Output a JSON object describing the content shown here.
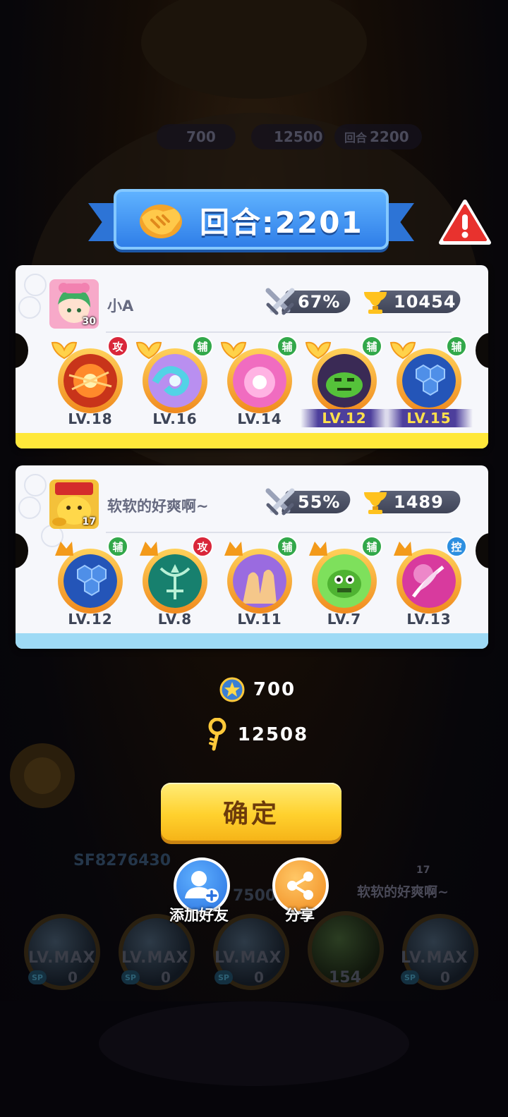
{
  "background": {
    "hud": {
      "stars": "700",
      "keys": "12500",
      "round_label": "回合",
      "round_value": "2200"
    },
    "score_id": "SF8276430",
    "center_value": "7500",
    "opponent_name": "软软的好爽啊~",
    "opponent_level": "17",
    "bottom_levels": [
      "LV.MAX",
      "LV.MAX",
      "LV.MAX",
      "LV.MAX"
    ],
    "sp_label": "SP",
    "sp_values": [
      "0",
      "0",
      "0",
      "0"
    ],
    "center_count": "154"
  },
  "title": {
    "text": "回合:2201",
    "color": "#2f7ee8"
  },
  "players": [
    {
      "name": "小A",
      "level": "30",
      "win_rate": "67%",
      "trophies": "10454",
      "band_color": "#ffe83a",
      "heroes": [
        {
          "badge": "攻",
          "badge_color": "#d9263a",
          "level": "LV.18",
          "highlight": false,
          "orb": "fire-orb"
        },
        {
          "badge": "辅",
          "badge_color": "#32a84a",
          "level": "LV.16",
          "highlight": false,
          "orb": "wave-orb"
        },
        {
          "badge": "辅",
          "badge_color": "#32a84a",
          "level": "LV.14",
          "highlight": false,
          "orb": "pink-orb"
        },
        {
          "badge": "辅",
          "badge_color": "#32a84a",
          "level": "LV.12",
          "highlight": true,
          "orb": "slime-orb"
        },
        {
          "badge": "辅",
          "badge_color": "#32a84a",
          "level": "LV.15",
          "highlight": true,
          "orb": "hex-orb"
        }
      ]
    },
    {
      "name": "软软的好爽啊~",
      "level": "17",
      "win_rate": "55%",
      "trophies": "1489",
      "band_color": "#9edaf5",
      "heroes": [
        {
          "badge": "辅",
          "badge_color": "#32a84a",
          "level": "LV.12",
          "highlight": false,
          "orb": "hex-orb"
        },
        {
          "badge": "攻",
          "badge_color": "#d9263a",
          "level": "LV.8",
          "highlight": false,
          "orb": "bow-orb"
        },
        {
          "badge": "辅",
          "badge_color": "#32a84a",
          "level": "LV.11",
          "highlight": false,
          "orb": "shadow-orb"
        },
        {
          "badge": "辅",
          "badge_color": "#32a84a",
          "level": "LV.7",
          "highlight": false,
          "orb": "goblin-orb"
        },
        {
          "badge": "控",
          "badge_color": "#2d8fe0",
          "level": "LV.13",
          "highlight": false,
          "orb": "feather-orb"
        }
      ]
    }
  ],
  "rewards": {
    "stars": "700",
    "keys": "12508"
  },
  "buttons": {
    "confirm": "确定",
    "add_friend": "添加好友",
    "share": "分享"
  },
  "icons": [
    "handshake-icon",
    "warning-icon",
    "crossed-swords-icon",
    "trophy-icon",
    "star-coin-icon",
    "key-icon",
    "add-friend-icon",
    "share-icon",
    "butterfly-wing-icon"
  ]
}
